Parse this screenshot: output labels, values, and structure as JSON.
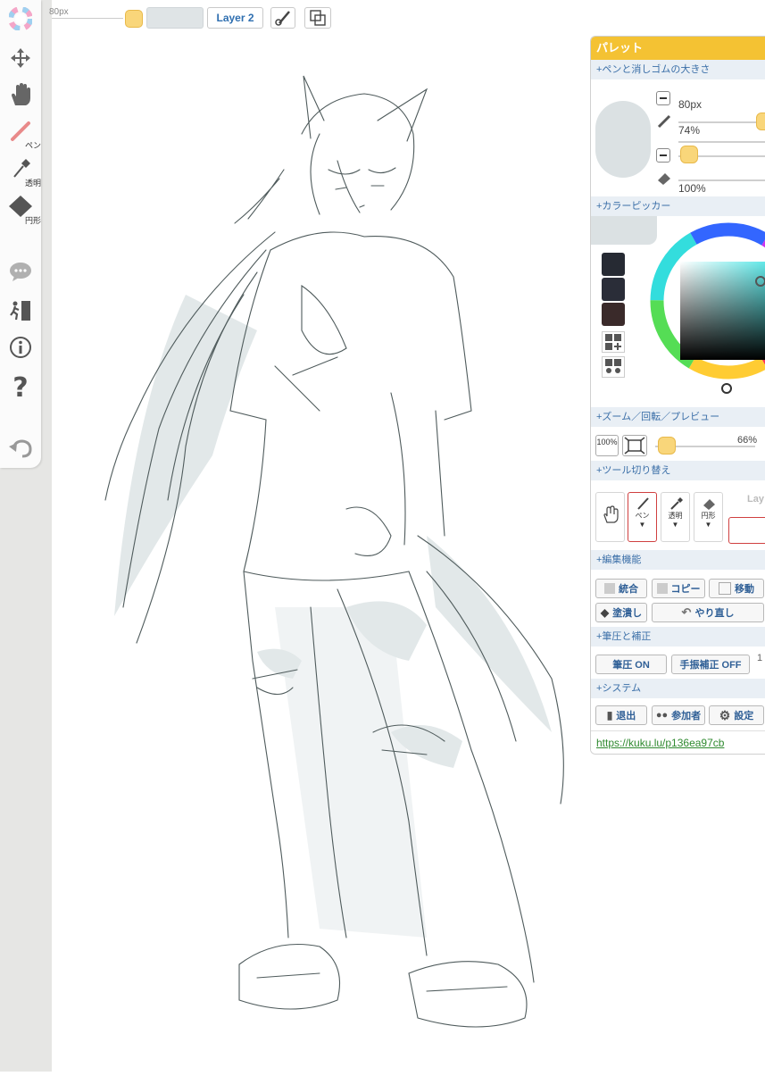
{
  "topbar": {
    "brush_size": "80px",
    "layer_name": "Layer 2"
  },
  "tools": {
    "pen_label": "ペン",
    "transparent_label": "透明",
    "circle_label": "円形"
  },
  "palette": {
    "title": "パレット",
    "sections": {
      "size": "+ペンと消しゴムの大きさ",
      "color": "+カラーピッカー",
      "zoom": "+ズーム／回転／プレビュー",
      "tools": "+ツール切り替え",
      "edit": "+編集機能",
      "pressure": "+筆圧と補正",
      "system": "+システム"
    },
    "pen_size": "80px",
    "pen_opacity": "74%",
    "eraser_opacity": "100%",
    "zoom_reset": "100%",
    "zoom_value": "66%",
    "tool_labels": [
      "ペン",
      "透明",
      "円形"
    ],
    "layer_peek": "Lay",
    "edit_buttons": {
      "merge": "統合",
      "copy": "コピー",
      "move": "移動",
      "fill": "塗潰し",
      "redo": "やり直し"
    },
    "pressure_on": "筆圧 ON",
    "stabilizer_off": "手振補正 OFF",
    "stabilizer_peek": "1",
    "system_buttons": {
      "exit": "退出",
      "participants": "参加者",
      "settings": "設定"
    },
    "room_url": "https://kuku.lu/p136ea97cb",
    "swatches": [
      "#262a33",
      "#2a2d38",
      "#3a2a2a"
    ]
  },
  "colors": {
    "accent": "#f4c233",
    "link": "#2f8a2f",
    "selected_border": "#d04040"
  }
}
